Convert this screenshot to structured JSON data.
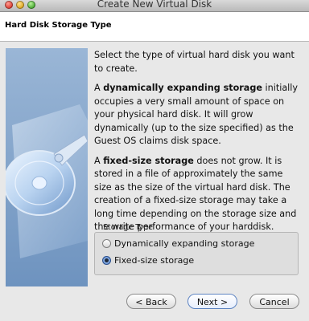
{
  "window": {
    "title": "Create New Virtual Disk"
  },
  "header": {
    "title": "Hard Disk Storage Type"
  },
  "content": {
    "intro": "Select the type of virtual hard disk you want to create.",
    "dynamic_bold": "dynamically expanding storage",
    "dynamic_lead": "A ",
    "dynamic_rest": " initially occupies a very small amount of space on your physical hard disk. It will grow dynamically (up to the size specified) as the Guest OS claims disk space.",
    "fixed_lead": "A ",
    "fixed_bold": "fixed-size storage",
    "fixed_rest": " does not grow. It is stored in a file of approximately the same size as the size of the virtual hard disk. The creation of a fixed-size storage may take a long time depending on the storage size and the write performance of your harddisk."
  },
  "storage_type": {
    "group_title": "Storage Type",
    "options": [
      {
        "label": "Dynamically expanding storage",
        "selected": false
      },
      {
        "label": "Fixed-size storage",
        "selected": true
      }
    ]
  },
  "buttons": {
    "back": "< Back",
    "next": "Next >",
    "cancel": "Cancel"
  },
  "colors": {
    "side_panel_top": "#9ab6d6",
    "side_panel_bottom": "#6e93bf",
    "default_button_border": "#5d84c2"
  }
}
